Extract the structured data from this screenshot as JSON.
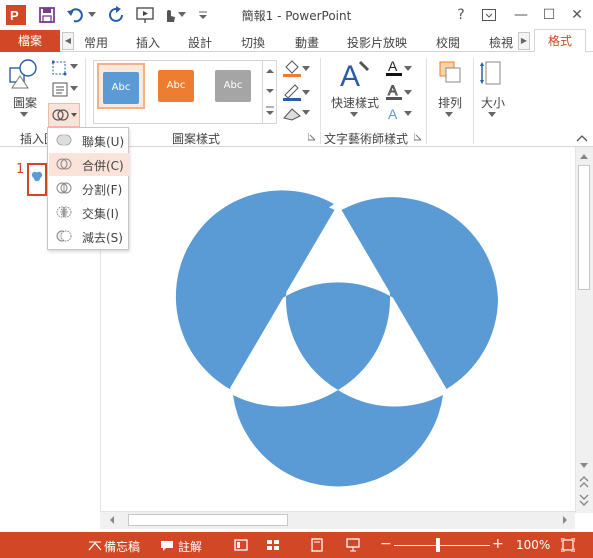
{
  "window": {
    "title": "簡報1 - PowerPoint",
    "help": "?",
    "minimize": "—",
    "maximize": "☐",
    "close": "✕"
  },
  "tabs": {
    "file": "檔案",
    "items": [
      "常用",
      "插入",
      "設計",
      "切換",
      "動畫",
      "投影片放映",
      "校閱",
      "檢視"
    ],
    "active": "格式"
  },
  "ribbon": {
    "insert_shapes": {
      "shapes_label": "圖案",
      "group_label": "插入圖"
    },
    "shape_styles": {
      "group_label": "圖案樣式",
      "styles": [
        {
          "text": "Abc",
          "color": "#5b9bd5",
          "border": "#f4b183"
        },
        {
          "text": "Abc",
          "color": "#ed7d31",
          "border": "#ffffff"
        },
        {
          "text": "Abc",
          "color": "#a5a5a5",
          "border": "#ffffff"
        }
      ]
    },
    "wordart": {
      "quick_styles_label": "快速樣式",
      "group_label": "文字藝術師樣式"
    },
    "arrange": {
      "label": "排列"
    },
    "size": {
      "label": "大小"
    }
  },
  "merge_menu": {
    "items": [
      {
        "label": "聯集(U)",
        "active": false
      },
      {
        "label": "合併(C)",
        "active": true
      },
      {
        "label": "分割(F)",
        "active": false
      },
      {
        "label": "交集(I)",
        "active": false
      },
      {
        "label": "減去(S)",
        "active": false
      }
    ]
  },
  "slides": {
    "current_number": "1"
  },
  "canvas": {
    "shape_color": "#5b9bd5"
  },
  "status": {
    "notes": "備忘稿",
    "comments": "註解",
    "zoom": "100%",
    "zoom_minus": "−",
    "zoom_plus": "+"
  },
  "colors": {
    "accent": "#d24726"
  }
}
